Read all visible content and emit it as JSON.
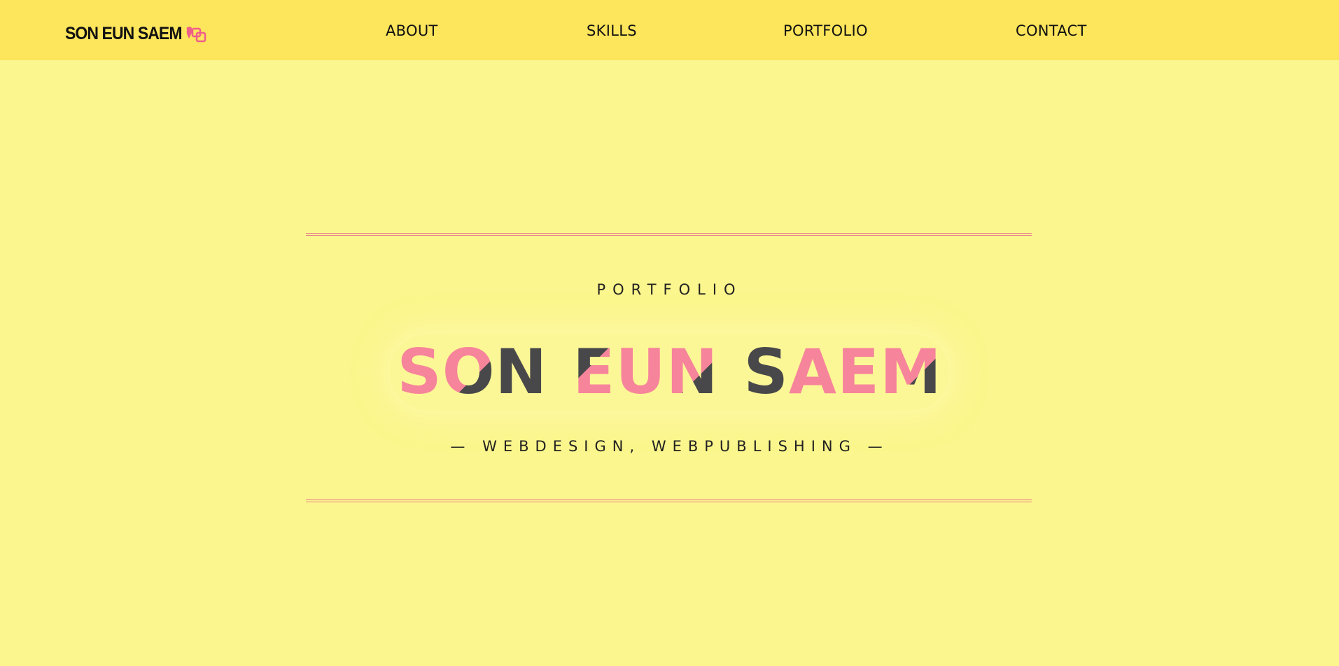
{
  "header": {
    "logo_text": "SON EUN SAEM",
    "logo_icon": "pink-heart-squares-icon",
    "nav": [
      {
        "label": "ABOUT"
      },
      {
        "label": "SKILLS"
      },
      {
        "label": "PORTFOLIO"
      },
      {
        "label": "CONTACT"
      }
    ]
  },
  "hero": {
    "kicker": "PORTFOLIO",
    "name": "SON EUN SAEM",
    "tagline": "— WEBDESIGN, WEBPUBLISHING —"
  },
  "colors": {
    "header_bg": "#fde55c",
    "page_bg": "#fbf68d",
    "accent_pink": "#f6849b",
    "text_dark": "#48484a",
    "rule": "#e77f8f"
  }
}
